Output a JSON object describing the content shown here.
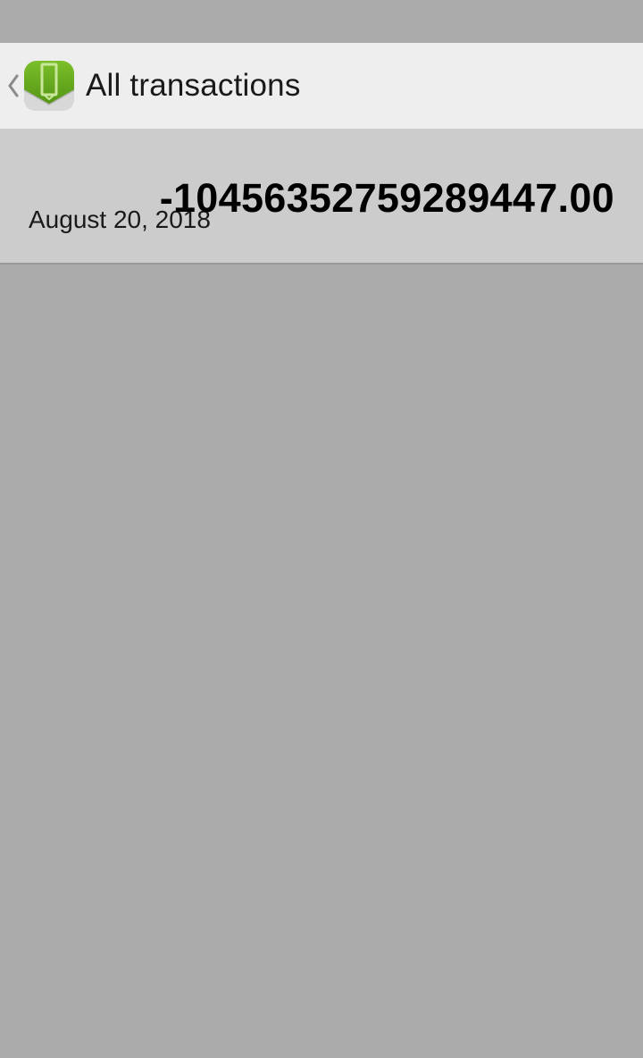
{
  "header": {
    "title": "All transactions",
    "back_icon": "chevron-left-icon",
    "app_icon": "wallet-app-icon"
  },
  "transactions": [
    {
      "date": "August 20, 2018",
      "amount": "-10456352759289447.00"
    }
  ],
  "colors": {
    "background": "#aaaaaa",
    "action_bar": "#eeeeee",
    "row_background": "#cccccc",
    "row_divider": "#999999",
    "icon_green": "#6aaa1e"
  }
}
